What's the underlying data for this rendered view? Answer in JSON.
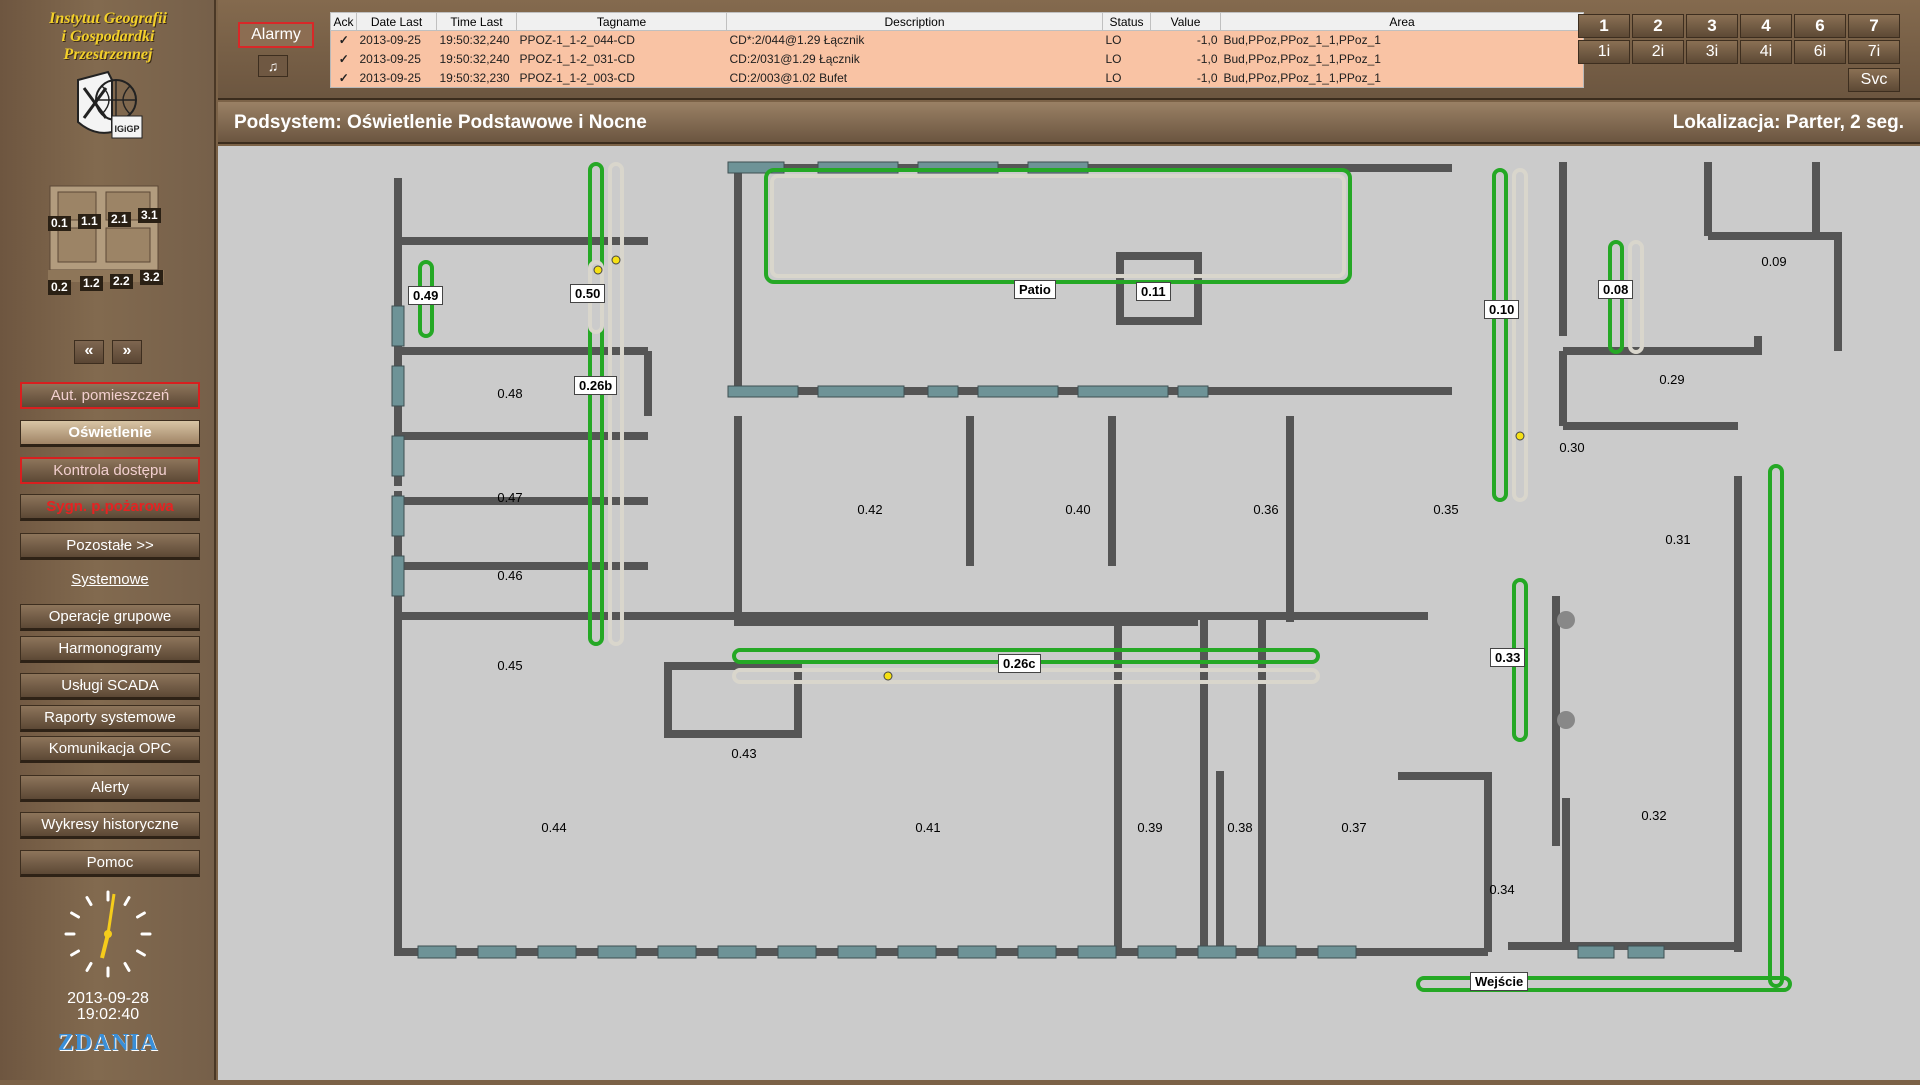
{
  "sidebar": {
    "logo_line1": "Instytut Geografii",
    "logo_line2": "i Gospodardki",
    "logo_line3": "Przestrzennej",
    "logo_badge": "IGiGP",
    "floors": [
      "0.1",
      "1.1",
      "2.1",
      "3.1",
      "0.2",
      "1.2",
      "2.2",
      "3.2"
    ],
    "prev_label": "«",
    "next_label": "»",
    "menu": [
      "Aut. pomieszczeń",
      "Oświetlenie",
      "Kontrola dostępu",
      "Sygn. p.pożarowa",
      "Pozostałe  >>",
      "Systemowe",
      "Operacje grupowe",
      "Harmonogramy",
      "Usługi SCADA",
      "Raporty systemowe",
      "Komunikacja OPC",
      "Alerty",
      "Wykresy historyczne",
      "Pomoc"
    ],
    "date": "2013-09-28",
    "time": "19:02:40",
    "brand": "ZDANIA"
  },
  "topbar": {
    "alarm_button": "Alarmy",
    "bell_icon": "bell-icon",
    "columns": [
      "Ack",
      "Date Last",
      "Time Last",
      "Tagname",
      "Description",
      "Status",
      "Value",
      "Area"
    ],
    "rows": [
      [
        "✓",
        "2013-09-25",
        "19:50:32,240",
        "PPOZ-1_1-2_044-CD",
        "CD*:2/044@1.29 Łącznik",
        "LO",
        "-1,0",
        "Bud,PPoz,PPoz_1_1,PPoz_1"
      ],
      [
        "✓",
        "2013-09-25",
        "19:50:32,240",
        "PPOZ-1_1-2_031-CD",
        "CD:2/031@1.29 Łącznik",
        "LO",
        "-1,0",
        "Bud,PPoz,PPoz_1_1,PPoz_1"
      ],
      [
        "✓",
        "2013-09-25",
        "19:50:32,230",
        "PPOZ-1_1-2_003-CD",
        "CD:2/003@1.02 Bufet",
        "LO",
        "-1,0",
        "Bud,PPoz,PPoz_1_1,PPoz_1"
      ]
    ],
    "cameras_top": [
      "1",
      "2",
      "3",
      "4",
      "6",
      "7"
    ],
    "cameras_bottom": [
      "1i",
      "2i",
      "3i",
      "4i",
      "6i",
      "7i"
    ],
    "svc": "Svc"
  },
  "header": {
    "subsystem": "Podsystem: Oświetlenie Podstawowe i Nocne",
    "location": "Lokalizacja: Parter, 2 seg."
  },
  "plan": {
    "rooms": [
      "0.48",
      "0.47",
      "0.46",
      "0.45",
      "0.44",
      "0.43",
      "0.42",
      "0.41",
      "0.40",
      "0.39",
      "0.38",
      "0.37",
      "0.36",
      "0.35",
      "0.34",
      "0.32",
      "0.31",
      "0.30",
      "0.29",
      "0.09"
    ],
    "tags": [
      "0.49",
      "0.50",
      "0.26b",
      "Patio",
      "0.11",
      "0.10",
      "0.08",
      "0.26c",
      "0.33",
      "Wejście"
    ]
  }
}
